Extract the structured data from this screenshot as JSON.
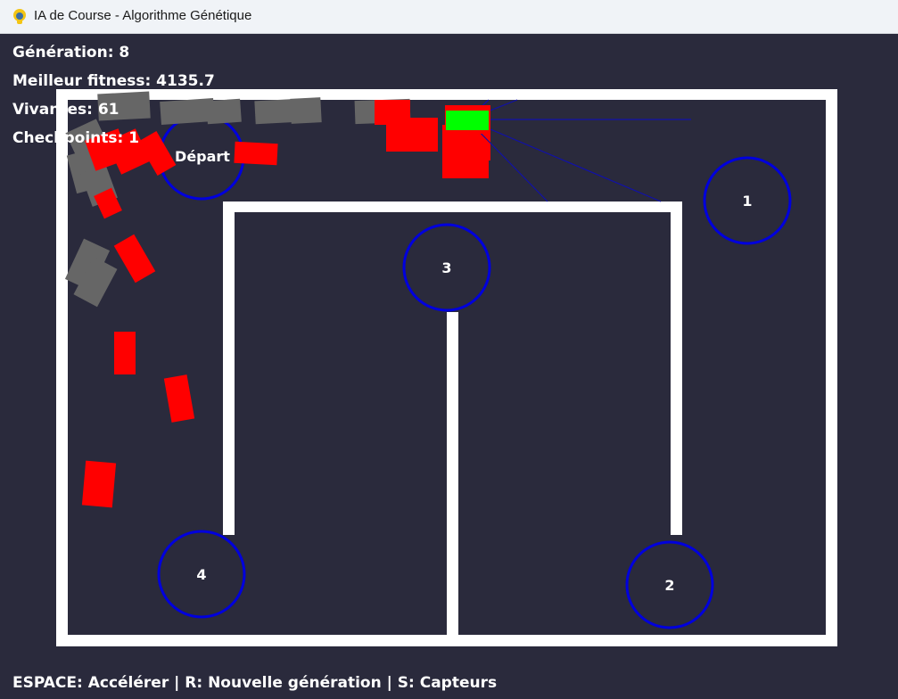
{
  "window": {
    "title": "IA de Course - Algorithme Génétique",
    "icon": "pygame-snake-icon"
  },
  "hud": {
    "generation": "Génération: 8",
    "best_fitness": "Meilleur fitness: 4135.7",
    "alive": "Vivantes: 61",
    "checkpoints": "Checkpoints: 1"
  },
  "track": {
    "start_label": "Départ",
    "checkpoints": [
      "1",
      "2",
      "3",
      "4"
    ],
    "wall_color": "#ffffff",
    "checkpoint_color": "#0000dd",
    "background_color": "#2a2a3c"
  },
  "cars": {
    "best_color": "#00ff00",
    "alive_color": "#ff0000",
    "dead_color": "#666666",
    "sensor_color": "#0000aa"
  },
  "footer": {
    "controls": "ESPACE: Accélérer | R: Nouvelle génération | S: Capteurs"
  }
}
